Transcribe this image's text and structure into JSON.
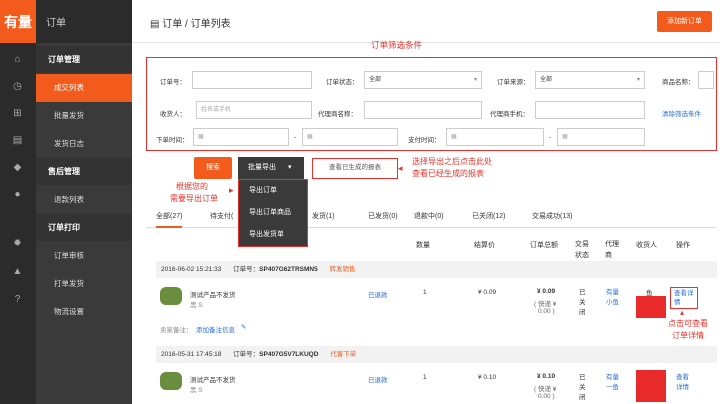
{
  "brand": {
    "logo": "有量",
    "section": "订单"
  },
  "header": {
    "icon": "document-icon",
    "crumb_root": "订单",
    "crumb_sep": "/",
    "crumb_page": "订单列表",
    "add_button": "添加新订单"
  },
  "sidebar": {
    "groups": [
      {
        "title": "订单管理",
        "items": [
          "成交列表",
          "批量发货",
          "发货日志"
        ]
      },
      {
        "title": "售后管理",
        "items": [
          "退款列表"
        ]
      },
      {
        "title": "订单打印",
        "items": [
          "订单审核",
          "打单发货",
          "物流设置"
        ]
      }
    ],
    "active_item": "成交列表",
    "icons": [
      "home-icon",
      "clock-icon",
      "org-icon",
      "document-icon",
      "tag-icon",
      "piggy-icon",
      "gear-icon",
      "bell-icon",
      "help-icon"
    ]
  },
  "filters": {
    "order_no": "订单号：",
    "order_status": "订单状态：",
    "order_status_value": "全部",
    "order_source": "订单来源：",
    "order_source_value": "全部",
    "product_name": "商品名称：",
    "receiver": "收货人：",
    "receiver_placeholder": "姓名或手机",
    "agent_name": "代理商名称：",
    "agent_phone": "代理商手机：",
    "clear": "清除筛选条件",
    "order_time": "下单时间：",
    "pay_time": "支付时间：",
    "dash": "-"
  },
  "actions": {
    "search": "搜索",
    "export": "批量导出",
    "view_report": "查看已生成的报表"
  },
  "export_menu": [
    "导出订单",
    "导出订单商品",
    "导出发货单"
  ],
  "annotations": {
    "filter": "订单筛选条件",
    "export_l1": "根据您的",
    "export_l2": "需要导出订单",
    "report_l1": "选择导出之后点击此处",
    "report_l2": "查看已经生成的报表",
    "detail_l1": "点击可查看",
    "detail_l2": "订单详情"
  },
  "tabs": [
    "全部(27)",
    "待支付(",
    "发货(1)",
    "已发货(0)",
    "退款中(0)",
    "已关闭(12)",
    "交易成功(13)"
  ],
  "columns": [
    "数量",
    "结算价",
    "订单总额",
    "交易状态",
    "代理商",
    "收货人",
    "操作"
  ],
  "orders": [
    {
      "time": "2016-06-02 15:21:33",
      "no_label": "订单号：",
      "no": "SP407G62TRSMN5",
      "tag": "转发销售",
      "product": "测试产品不发货",
      "spec": "黑 S",
      "refund": "已退款",
      "qty": "1",
      "price": "¥ 0.09",
      "total": "¥ 0.09",
      "total_sub": "( 快递 ¥",
      "total_sub2": "0.00 )",
      "status": "已关闭",
      "agent": "有量小鱼",
      "receiver": "鱼",
      "op": "查看详情",
      "note_label": "卖家备注：",
      "note_link": "添加备注信息"
    },
    {
      "time": "2016-05-31 17:45:18",
      "no_label": "订单号：",
      "no": "SP407G5V7LKUQD",
      "tag": "代客下单",
      "product": "测试产品不发货",
      "spec": "黑 S",
      "refund": "已退款",
      "qty": "1",
      "price": "¥ 0.10",
      "total": "¥ 0.10",
      "total_sub": "( 快递 ¥",
      "total_sub2": "0.00 )",
      "status": "已关闭",
      "agent": "有量一鱼",
      "op": "查看详情"
    }
  ]
}
